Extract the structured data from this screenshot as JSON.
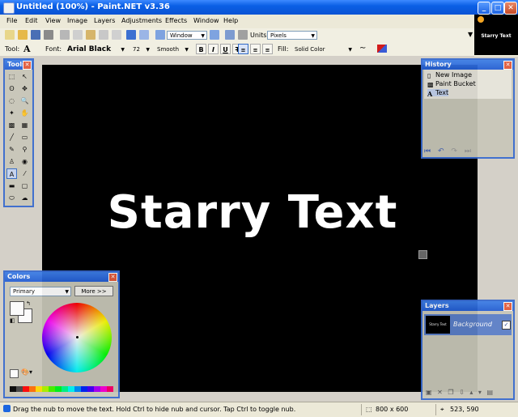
{
  "window": {
    "title": "Untitled (100%) - Paint.NET v3.36",
    "minimize": "_",
    "maximize": "□",
    "close": "✕"
  },
  "menu": [
    "File",
    "Edit",
    "View",
    "Image",
    "Layers",
    "Adjustments",
    "Effects",
    "Window",
    "Help"
  ],
  "toolbar": {
    "zoom_select": "Window",
    "units_label": "Units:",
    "units_value": "Pixels",
    "tool_label": "Tool:",
    "tool_icon": "A",
    "font_label": "Font:",
    "font_value": "Arial Black",
    "font_size": "72",
    "antialias": "Smooth",
    "bold": "B",
    "italic": "I",
    "underline": "U",
    "strike": "T",
    "fill_label": "Fill:",
    "fill_value": "Solid Color"
  },
  "preview": {
    "thumb_text": "Starry Text"
  },
  "canvas": {
    "text": "Starry Text",
    "background": "#000000"
  },
  "tools_panel": {
    "title": "Tools",
    "icons": [
      "rect-select-icon",
      "move-select-icon",
      "lasso-icon",
      "move-pixels-icon",
      "ellipse-select-icon",
      "zoom-icon",
      "magic-wand-icon",
      "pan-icon",
      "paint-bucket-icon",
      "gradient-icon",
      "paintbrush-icon",
      "eraser-icon",
      "pencil-icon",
      "color-picker-icon",
      "clone-stamp-icon",
      "recolor-icon",
      "text-icon",
      "line-icon",
      "rectangle-icon",
      "rounded-rect-icon",
      "ellipse-icon",
      "freeform-icon"
    ],
    "glyphs": [
      "⬚",
      "↖",
      "ʘ",
      "✥",
      "◌",
      "🔍",
      "✦",
      "✋",
      "▩",
      "▦",
      "╱",
      "▭",
      "✎",
      "⚲",
      "♙",
      "◉",
      "A",
      "⁄",
      "▬",
      "▢",
      "⬭",
      "☁"
    ]
  },
  "history_panel": {
    "title": "History",
    "items": [
      "New Image",
      "Paint Bucket",
      "Text"
    ],
    "glyphs": [
      "▯",
      "▩",
      "A"
    ]
  },
  "colors_panel": {
    "title": "Colors",
    "select": "Primary",
    "more_button": "More >>",
    "palette": [
      "#000000",
      "#404040",
      "#ff0000",
      "#ff6a00",
      "#ffd800",
      "#b6ff00",
      "#4cff00",
      "#00ff21",
      "#00ff90",
      "#00ffff",
      "#0094ff",
      "#0026ff",
      "#4800ff",
      "#b200ff",
      "#ff00dc",
      "#ff006e"
    ]
  },
  "layers_panel": {
    "title": "Layers",
    "layer_name": "Background",
    "thumb_text": "Starry Text"
  },
  "status": {
    "message": "Drag the nub to move the text. Hold Ctrl to hide nub and cursor. Tap Ctrl to toggle nub.",
    "image_size": "800 x 600",
    "cursor_pos": "523, 590"
  }
}
